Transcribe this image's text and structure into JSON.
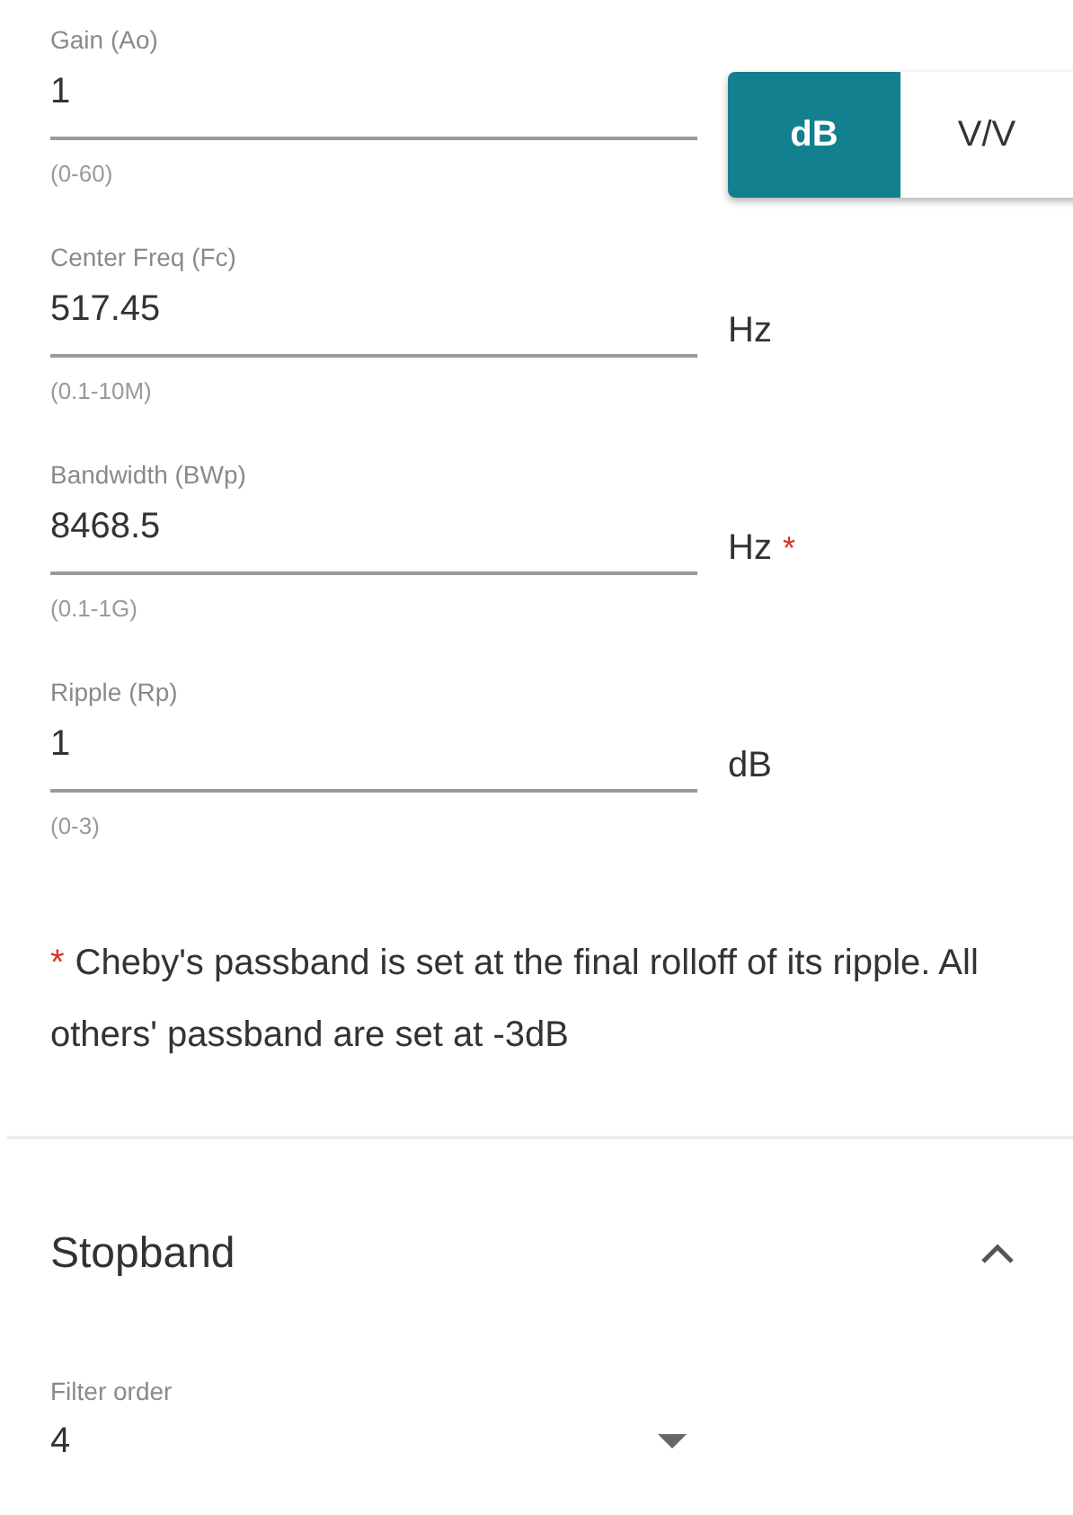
{
  "fields": [
    {
      "label": "Gain (Ao)",
      "value": "1",
      "hint": "(0-60)",
      "unit": {
        "kind": "toggle",
        "options": [
          {
            "label": "dB",
            "selected": true
          },
          {
            "label": "V/V",
            "selected": false
          }
        ]
      }
    },
    {
      "label": "Center Freq (Fc)",
      "value": "517.45",
      "hint": "(0.1-10M)",
      "unit": {
        "kind": "text",
        "text": "Hz"
      }
    },
    {
      "label": "Bandwidth (BWp)",
      "value": "8468.5",
      "hint": "(0.1-1G)",
      "unit": {
        "kind": "text",
        "text": "Hz",
        "marker": "*"
      }
    },
    {
      "label": "Ripple (Rp)",
      "value": "1",
      "hint": "(0-3)",
      "unit": {
        "kind": "text",
        "text": "dB"
      }
    }
  ],
  "note": {
    "marker": "*",
    "text": "Cheby's passband is set at the final rolloff of its ripple. All others' passband are set at -3dB"
  },
  "stopband": {
    "title": "Stopband",
    "expanded": true,
    "filter_order": {
      "label": "Filter order",
      "value": "4"
    }
  }
}
